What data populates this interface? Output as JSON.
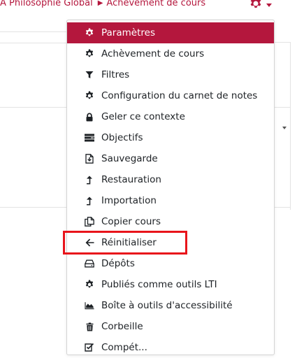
{
  "breadcrumb": {
    "items": [
      "A Philosophie Global",
      "Achèvement de cours"
    ]
  },
  "menu": {
    "items": [
      {
        "label": "Paramètres",
        "icon": "gear-icon",
        "active": true
      },
      {
        "label": "Achèvement de cours",
        "icon": "gear-icon"
      },
      {
        "label": "Filtres",
        "icon": "filter-icon"
      },
      {
        "label": "Configuration du carnet de notes",
        "icon": "gear-icon"
      },
      {
        "label": "Geler ce contexte",
        "icon": "lock-icon"
      },
      {
        "label": "Objectifs",
        "icon": "objectives-icon"
      },
      {
        "label": "Sauvegarde",
        "icon": "backup-file-icon"
      },
      {
        "label": "Restauration",
        "icon": "level-up-icon"
      },
      {
        "label": "Importation",
        "icon": "level-up-icon"
      },
      {
        "label": "Copier cours",
        "icon": "copy-icon"
      },
      {
        "label": "Réinitialiser",
        "icon": "arrow-left-icon"
      },
      {
        "label": "Dépôts",
        "icon": "hdd-icon"
      },
      {
        "label": "Publiés comme outils LTI",
        "icon": "gear-icon"
      },
      {
        "label": "Boîte à outils d'accessibilité",
        "icon": "area-chart-icon"
      },
      {
        "label": "Corbeille",
        "icon": "trash-icon"
      },
      {
        "label": "Compét...",
        "icon": "checkbox-icon"
      }
    ]
  },
  "colors": {
    "accent": "#b4173d",
    "highlight": "#e8141b"
  }
}
